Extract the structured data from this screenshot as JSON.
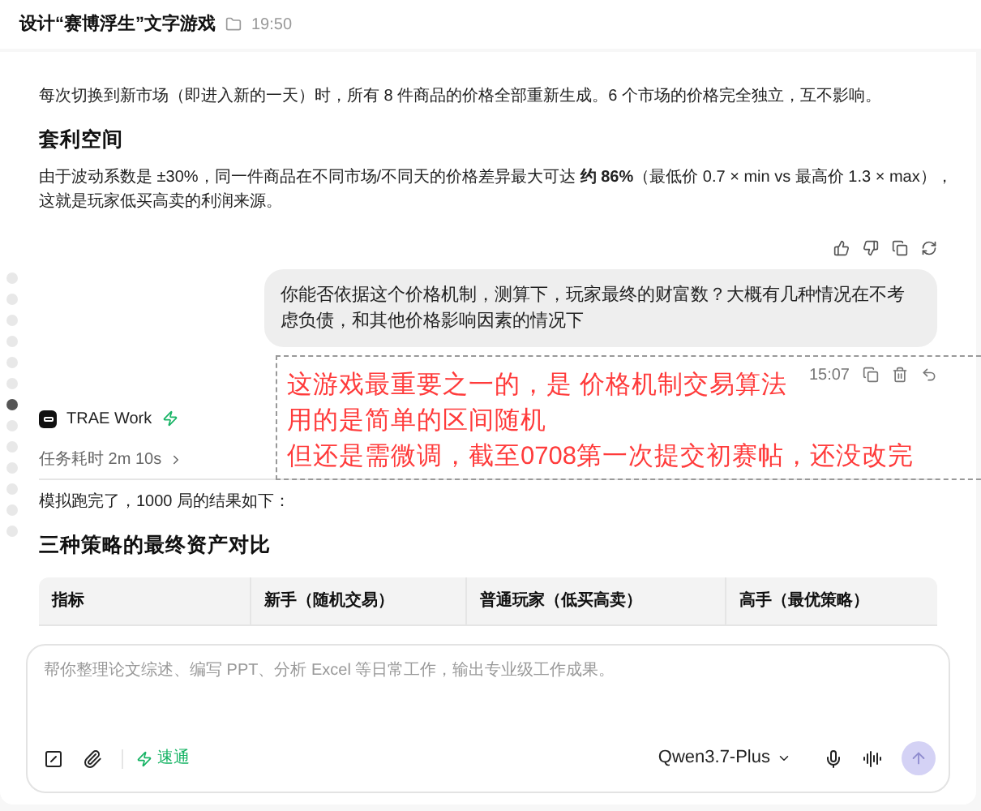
{
  "header": {
    "title": "设计“赛博浮生”文字游戏",
    "time": "19:50"
  },
  "messages": [
    {
      "kind": "assistant_text",
      "blocks": [
        {
          "kind": "paragraph",
          "text": "每次切换到新市场（即进入新的一天）时，所有 8 件商品的价格全部重新生成。6 个市场的价格完全独立，互不影响。"
        },
        {
          "kind": "heading",
          "text": "套利空间"
        },
        {
          "kind": "paragraph",
          "text": "由于波动系数是 ±30%，同一件商品在不同市场/不同天的价格差异最大可达 **约 86%**（最低价 0.7 × min vs 最高价 1.3 × max），这就是玩家低买高卖的利润来源。"
        }
      ]
    },
    {
      "kind": "user",
      "text": "你能否依据这个价格机制，测算下，玩家最终的财富数？大概有几种情况在不考虑负债，和其他价格影响因素的情况下",
      "time": "15:07"
    },
    {
      "kind": "assistant_reply",
      "agent": "TRAE Work",
      "duration": "任务耗时 2m 10s",
      "blocks": [
        {
          "kind": "paragraph",
          "text": "模拟跑完了，1000 局的结果如下："
        },
        {
          "kind": "heading",
          "text": "三种策略的最终资产对比"
        }
      ],
      "table": {
        "columns": [
          "指标",
          "新手（随机交易）",
          "普通玩家（低买高卖）",
          "高手（最优策略）"
        ]
      }
    }
  ],
  "annotation": {
    "lines": [
      "这游戏最重要之一的，是 价格机制交易算法",
      "用的是简单的区间随机",
      "但还是需微调，截至0708第一次提交初赛帖，还没改完"
    ]
  },
  "timeline": {
    "dots": [
      {
        "selected": false
      },
      {
        "selected": false
      },
      {
        "selected": false
      },
      {
        "selected": false
      },
      {
        "selected": false
      },
      {
        "selected": false
      },
      {
        "selected": true
      },
      {
        "selected": false
      },
      {
        "selected": false
      },
      {
        "selected": false
      },
      {
        "selected": false
      },
      {
        "selected": false
      },
      {
        "selected": false
      }
    ]
  },
  "composer": {
    "placeholder": "帮你整理论文综述、编写 PPT、分析 Excel 等日常工作，输出专业级工作成果。",
    "mode": "速通",
    "model": "Qwen3.7-Plus"
  }
}
